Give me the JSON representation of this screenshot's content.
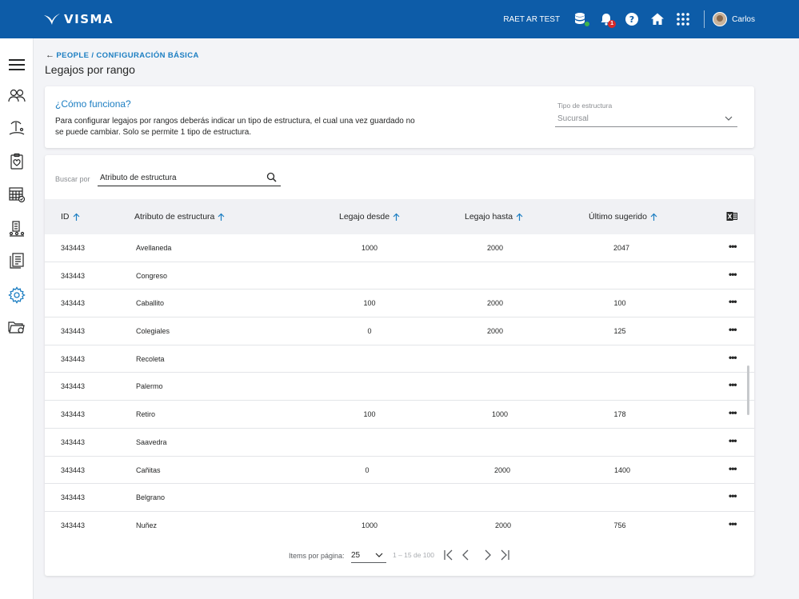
{
  "brand": {
    "name": "VISMA"
  },
  "topbar": {
    "company": "RAET AR TEST",
    "notification_count": "1",
    "user_name": "Carlos",
    "icons": [
      "database-icon",
      "bell-icon",
      "help-icon",
      "home-icon",
      "apps-grid-icon",
      "avatar"
    ]
  },
  "sidebar": {
    "items": [
      "menu-icon",
      "people-icon",
      "vacation-icon",
      "clipboard-icon",
      "calendar-icon",
      "organization-icon",
      "documents-icon",
      "settings-icon",
      "folders-icon"
    ]
  },
  "breadcrumb": {
    "parent": "PEOPLE",
    "separator": "/",
    "current": "CONFIGURACIÓN BÁSICA"
  },
  "page_title": "Legajos por rango",
  "info": {
    "title": "¿Cómo funciona?",
    "text": "Para configurar legajos por rangos deberás indicar un tipo de estructura, el cual una vez guardado no se puede cambiar. Solo se permite 1 tipo de estructura.",
    "structure_label": "Tipo de estructura",
    "structure_value": "Sucursal"
  },
  "search": {
    "label": "Buscar por",
    "value": "Atributo de estructura"
  },
  "table": {
    "columns": [
      "ID",
      "Atributo de estructura",
      "Legajo desde",
      "Legajo hasta",
      "Último sugerido"
    ],
    "rows": [
      {
        "id": "343443",
        "attr": "Avellaneda",
        "desde": "1000",
        "hasta": "2000",
        "sugerido": "2047"
      },
      {
        "id": "343443",
        "attr": "Congreso",
        "desde": "",
        "hasta": "",
        "sugerido": ""
      },
      {
        "id": "343443",
        "attr": "Caballito",
        "desde": "100",
        "hasta": "2000",
        "sugerido": "100"
      },
      {
        "id": "343443",
        "attr": "Colegiales",
        "desde": "0",
        "hasta": "2000",
        "sugerido": "125"
      },
      {
        "id": "343443",
        "attr": "Recoleta",
        "desde": "",
        "hasta": "",
        "sugerido": ""
      },
      {
        "id": "343443",
        "attr": "Palermo",
        "desde": "",
        "hasta": "",
        "sugerido": ""
      },
      {
        "id": "343443",
        "attr": "Retiro",
        "desde": "100",
        "hasta": "1000",
        "sugerido": "178"
      },
      {
        "id": "343443",
        "attr": "Saavedra",
        "desde": "",
        "hasta": "",
        "sugerido": ""
      },
      {
        "id": "343443",
        "attr": "Cañitas",
        "desde": "0",
        "hasta": "2000",
        "sugerido": "1400"
      },
      {
        "id": "343443",
        "attr": "Belgrano",
        "desde": "",
        "hasta": "",
        "sugerido": ""
      },
      {
        "id": "343443",
        "attr": "Nuñez",
        "desde": "1000",
        "hasta": "2000",
        "sugerido": "756"
      }
    ],
    "row_action": "•••"
  },
  "pagination": {
    "label": "Items por página:",
    "per_page": "25",
    "range": "1 – 15 de 100"
  },
  "colors": {
    "header": "#0d5ca8",
    "accent": "#1c7ec2",
    "notification": "#d72a2a",
    "status_ok": "#3fb44a"
  }
}
